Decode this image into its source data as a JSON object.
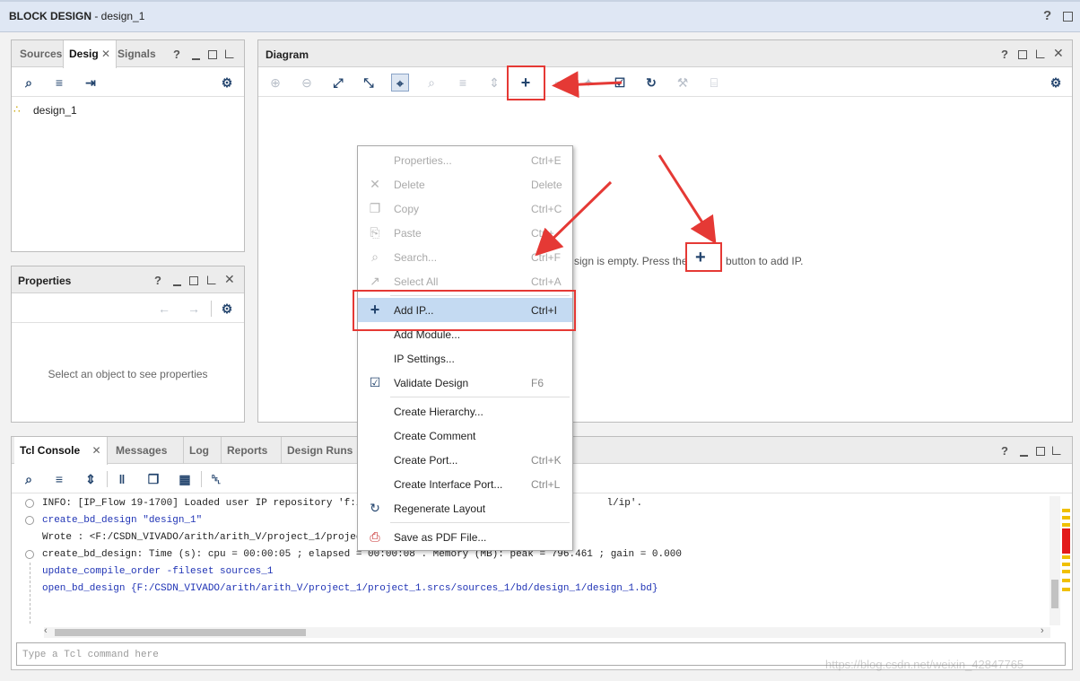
{
  "window": {
    "title_bold": "BLOCK DESIGN",
    "title_rest": " - design_1",
    "help": "?"
  },
  "sources_panel": {
    "tabs": [
      "Sources",
      "Desig",
      "Signals"
    ],
    "active_tab": "Desig",
    "controls": {
      "help": "?"
    },
    "tree": [
      {
        "label": "design_1"
      }
    ]
  },
  "properties_panel": {
    "title": "Properties",
    "help": "?",
    "empty_text": "Select an object to see properties"
  },
  "diagram_panel": {
    "title": "Diagram",
    "help": "?",
    "empty_text_left": "sign is empty. Press the",
    "empty_text_right": "button to add IP.",
    "add_symbol": "+"
  },
  "context_menu": {
    "items": [
      {
        "label": "Properties...",
        "shortcut": "Ctrl+E",
        "enabled": false,
        "icon": "none"
      },
      {
        "label": "Delete",
        "shortcut": "Delete",
        "enabled": false,
        "icon": "close-icon"
      },
      {
        "label": "Copy",
        "shortcut": "Ctrl+C",
        "enabled": false,
        "icon": "copy-icon"
      },
      {
        "label": "Paste",
        "shortcut": "Ctrl+",
        "enabled": false,
        "icon": "paste-icon"
      },
      {
        "label": "Search...",
        "shortcut": "Ctrl+F",
        "enabled": false,
        "icon": "search-icon"
      },
      {
        "label": "Select All",
        "shortcut": "Ctrl+A",
        "enabled": false,
        "icon": "select-all-icon"
      },
      {
        "label": "Add IP...",
        "shortcut": "Ctrl+I",
        "enabled": true,
        "highlighted": true,
        "icon": "plus-icon"
      },
      {
        "label": "Add Module...",
        "shortcut": "",
        "enabled": true,
        "icon": "none"
      },
      {
        "label": "IP Settings...",
        "shortcut": "",
        "enabled": true,
        "icon": "none"
      },
      {
        "label": "Validate Design",
        "shortcut": "F6",
        "enabled": true,
        "icon": "checkbox-icon"
      },
      {
        "label": "Create Hierarchy...",
        "shortcut": "",
        "enabled": true,
        "icon": "none"
      },
      {
        "label": "Create Comment",
        "shortcut": "",
        "enabled": true,
        "icon": "none"
      },
      {
        "label": "Create Port...",
        "shortcut": "Ctrl+K",
        "enabled": true,
        "icon": "none"
      },
      {
        "label": "Create Interface Port...",
        "shortcut": "Ctrl+L",
        "enabled": true,
        "icon": "none"
      },
      {
        "label": "Regenerate Layout",
        "shortcut": "",
        "enabled": true,
        "icon": "refresh-icon"
      },
      {
        "label": "Save as PDF File...",
        "shortcut": "",
        "enabled": true,
        "icon": "pdf-icon"
      }
    ]
  },
  "tcl_console": {
    "tabs": [
      "Tcl Console",
      "Messages",
      "Log",
      "Reports",
      "Design Runs"
    ],
    "active_tab": "Tcl Console",
    "help": "?",
    "lines": [
      {
        "text": "INFO: [IP_Flow 19-1700] Loaded user IP repository 'f:/CSDN_",
        "tail": "l/ip'.",
        "color": "black"
      },
      {
        "text": "create_bd_design \"design_1\"",
        "color": "blue"
      },
      {
        "text": "Wrote  : <F:/CSDN_VIVADO/arith/arith_V/project_1/project_1.",
        "color": "black"
      },
      {
        "text": "create_bd_design: Time (s): cpu = 00:00:05 ; elapsed = 00:00:08 . Memory (MB): peak = 796.461 ; gain = 0.000",
        "color": "black"
      },
      {
        "text": "update_compile_order -fileset sources_1",
        "color": "blue"
      },
      {
        "text": "open_bd_design {F:/CSDN_VIVADO/arith/arith_V/project_1/project_1.srcs/sources_1/bd/design_1/design_1.bd}",
        "color": "blue"
      }
    ],
    "input_placeholder": "Type a Tcl command here"
  },
  "watermark": "https://blog.csdn.net/weixin_42847765",
  "colors": {
    "annotation_red": "#e53935",
    "highlight": "#c4daf2",
    "icon_blue": "#24456e"
  }
}
